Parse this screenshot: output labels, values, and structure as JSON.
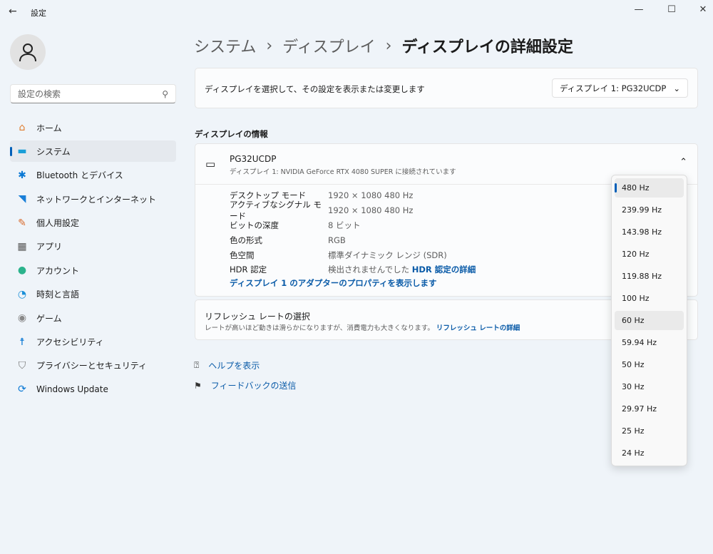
{
  "app": {
    "title": "設定",
    "back": "←",
    "minimize": "—",
    "maximize": "☐",
    "close": "✕"
  },
  "search": {
    "placeholder": "設定の検索"
  },
  "nav": [
    {
      "label": "ホーム",
      "icon": "home-icon",
      "glyph": "⌂",
      "color": "#e07b2c"
    },
    {
      "label": "システム",
      "icon": "system-icon",
      "glyph": "▬",
      "color": "#1a9fd8"
    },
    {
      "label": "Bluetooth とデバイス",
      "icon": "bluetooth-icon",
      "glyph": "✱",
      "color": "#0a78d4"
    },
    {
      "label": "ネットワークとインターネット",
      "icon": "wifi-icon",
      "glyph": "◥",
      "color": "#1a7fd8"
    },
    {
      "label": "個人用設定",
      "icon": "brush-icon",
      "glyph": "✎",
      "color": "#d86a2c"
    },
    {
      "label": "アプリ",
      "icon": "apps-icon",
      "glyph": "▦",
      "color": "#555"
    },
    {
      "label": "アカウント",
      "icon": "account-icon",
      "glyph": "●",
      "color": "#2bb38c"
    },
    {
      "label": "時刻と言語",
      "icon": "time-language-icon",
      "glyph": "◔",
      "color": "#1a8fd8"
    },
    {
      "label": "ゲーム",
      "icon": "game-icon",
      "glyph": "◉",
      "color": "#888"
    },
    {
      "label": "アクセシビリティ",
      "icon": "accessibility-icon",
      "glyph": "☨",
      "color": "#0a78d4"
    },
    {
      "label": "プライバシーとセキュリティ",
      "icon": "shield-icon",
      "glyph": "⛉",
      "color": "#777"
    },
    {
      "label": "Windows Update",
      "icon": "windows-update-icon",
      "glyph": "⟳",
      "color": "#0a78d4"
    }
  ],
  "breadcrumb": [
    "システム",
    "ディスプレイ",
    "ディスプレイの詳細設定"
  ],
  "select_display": {
    "label": "ディスプレイを選択して、その設定を表示または変更します",
    "value": "ディスプレイ 1: PG32UCDP"
  },
  "section_title": "ディスプレイの情報",
  "display": {
    "name": "PG32UCDP",
    "subtitle": "ディスプレイ 1: NVIDIA GeForce RTX 4080 SUPER に接続されています",
    "rows": [
      {
        "k": "デスクトップ モード",
        "v": "1920 × 1080 480 Hz"
      },
      {
        "k": "アクティブなシグナル モード",
        "v": "1920 × 1080 480 Hz"
      },
      {
        "k": "ビットの深度",
        "v": "8 ビット"
      },
      {
        "k": "色の形式",
        "v": "RGB"
      },
      {
        "k": "色空間",
        "v": "標準ダイナミック レンジ (SDR)"
      },
      {
        "k": "HDR 認定",
        "v": "検出されませんでした",
        "link": "HDR 認定の詳細"
      }
    ],
    "adapter_link": "ディスプレイ 1 のアダプターのプロパティを表示します"
  },
  "refresh": {
    "title": "リフレッシュ レートの選択",
    "desc": "レートが高いほど動きは滑らかになりますが、消費電力も大きくなります。",
    "link": "リフレッシュ レートの詳細",
    "options": [
      "480 Hz",
      "239.99 Hz",
      "143.98 Hz",
      "120 Hz",
      "119.88 Hz",
      "100 Hz",
      "60 Hz",
      "59.94 Hz",
      "50 Hz",
      "30 Hz",
      "29.97 Hz",
      "25 Hz",
      "24 Hz"
    ],
    "selected": "480 Hz"
  },
  "help": {
    "get_help": "ヘルプを表示",
    "feedback": "フィードバックの送信"
  }
}
